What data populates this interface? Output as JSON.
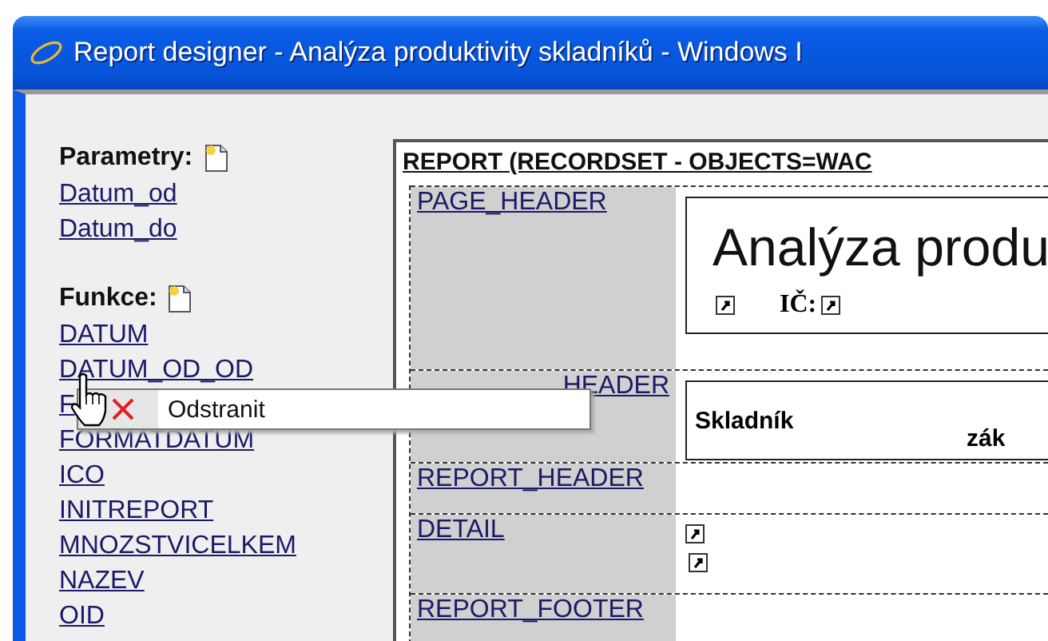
{
  "window": {
    "title": "Report designer - Analýza produktivity skladníků - Windows I"
  },
  "sidebar": {
    "sections": [
      {
        "heading": "Parametry:",
        "items": [
          "Datum_od",
          "Datum_do"
        ]
      },
      {
        "heading": "Funkce:",
        "items": [
          "DATUM",
          "DATUM_OD_OD",
          "F",
          "FORMATDATUM",
          "ICO",
          "INITREPORT",
          "MNOZSTVICELKEM",
          "NAZEV",
          "OID"
        ]
      }
    ]
  },
  "report": {
    "title": "REPORT (RECORDSET - OBJECTS=WAC",
    "sections": [
      {
        "kind": "title_box",
        "label": "PAGE_HEADER",
        "title": "Analýza produ",
        "caption": "IČ:"
      },
      {
        "kind": "column_box",
        "label": "HEADER",
        "columns": [
          "Skladník",
          "zák"
        ]
      },
      {
        "kind": "empty",
        "label": "REPORT_HEADER"
      },
      {
        "kind": "fields",
        "label": "DETAIL"
      },
      {
        "kind": "empty",
        "label": "REPORT_FOOTER"
      }
    ]
  },
  "context_menu": {
    "items": [
      {
        "label": "Odstranit"
      }
    ]
  }
}
